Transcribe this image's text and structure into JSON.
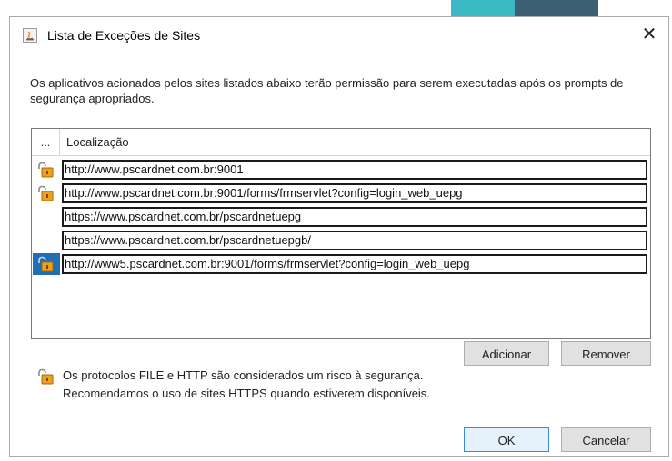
{
  "dialog": {
    "title": "Lista de Exceções de Sites",
    "close_glyph": "✕",
    "description": "Os aplicativos acionados pelos sites listados abaixo terão permissão para serem executadas após os prompts de segurança apropriados."
  },
  "table": {
    "col_icon_header": "...",
    "col_location_header": "Localização",
    "rows": [
      {
        "url": "http://www.pscardnet.com.br:9001",
        "icon": "unlocked-padlock-icon",
        "selected": false
      },
      {
        "url": "http://www.pscardnet.com.br:9001/forms/frmservlet?config=login_web_uepg",
        "icon": "unlocked-padlock-icon",
        "selected": false
      },
      {
        "url": "https://www.pscardnet.com.br/pscardnetuepg",
        "icon": "",
        "selected": false
      },
      {
        "url": "https://www.pscardnet.com.br/pscardnetuepgb/",
        "icon": "",
        "selected": false
      },
      {
        "url": "http://www5.pscardnet.com.br:9001/forms/frmservlet?config=login_web_uepg",
        "icon": "unlocked-padlock-icon",
        "selected": true
      }
    ]
  },
  "buttons": {
    "add": "Adicionar",
    "remove": "Remover",
    "ok": "OK",
    "cancel": "Cancelar"
  },
  "note": {
    "line1": "Os protocolos FILE e HTTP são considerados um risco à segurança.",
    "line2": "Recomendamos o uso de sites HTTPS quando estiverem disponíveis.",
    "icon": "unlocked-padlock-icon"
  },
  "colors": {
    "selection": "#1f6fb5",
    "primary_button_border": "#3c8ae0",
    "padlock": "#f0a020"
  }
}
